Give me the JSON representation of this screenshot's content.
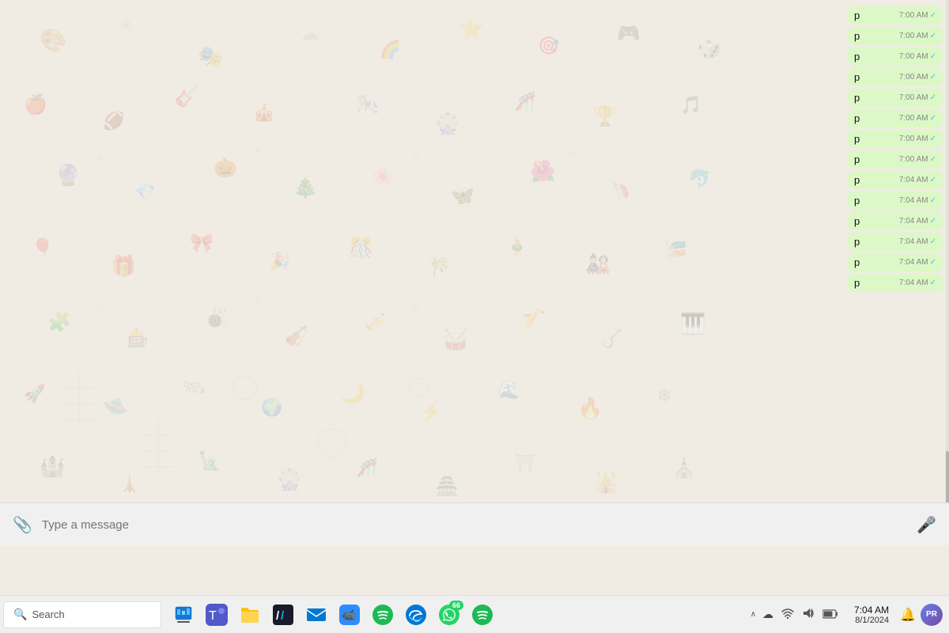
{
  "chat": {
    "background_color": "#f0ece4",
    "messages": [
      {
        "id": 1,
        "text": "p",
        "time": "7:00 AM",
        "read": true
      },
      {
        "id": 2,
        "text": "p",
        "time": "7:00 AM",
        "read": true
      },
      {
        "id": 3,
        "text": "p",
        "time": "7:00 AM",
        "read": true
      },
      {
        "id": 4,
        "text": "p",
        "time": "7:00 AM",
        "read": true
      },
      {
        "id": 5,
        "text": "p",
        "time": "7:00 AM",
        "read": true
      },
      {
        "id": 6,
        "text": "p",
        "time": "7:00 AM",
        "read": true
      },
      {
        "id": 7,
        "text": "p",
        "time": "7:00 AM",
        "read": true
      },
      {
        "id": 8,
        "text": "p",
        "time": "7:00 AM",
        "read": true
      },
      {
        "id": 9,
        "text": "p",
        "time": "7:04 AM",
        "read": true
      },
      {
        "id": 10,
        "text": "p",
        "time": "7:04 AM",
        "read": true
      },
      {
        "id": 11,
        "text": "p",
        "time": "7:04 AM",
        "read": true
      },
      {
        "id": 12,
        "text": "p",
        "time": "7:04 AM",
        "read": true
      },
      {
        "id": 13,
        "text": "p",
        "time": "7:04 AM",
        "read": true
      },
      {
        "id": 14,
        "text": "p",
        "time": "7:04 AM",
        "read": true
      }
    ],
    "input_placeholder": "Type a message"
  },
  "taskbar": {
    "search_placeholder": "Search",
    "search_label": "Search",
    "apps": [
      {
        "name": "task-manager",
        "emoji": "🖥",
        "label": "Task Manager"
      },
      {
        "name": "microsoft-teams",
        "emoji": "💬",
        "label": "Teams",
        "color": "#5059C9"
      },
      {
        "name": "file-explorer",
        "emoji": "📁",
        "label": "File Explorer"
      },
      {
        "name": "dashlane",
        "emoji": "🔑",
        "label": "Dashlane"
      },
      {
        "name": "mail",
        "emoji": "✉",
        "label": "Mail"
      },
      {
        "name": "zoom",
        "emoji": "📹",
        "label": "Zoom"
      },
      {
        "name": "spotify-1",
        "emoji": "🎵",
        "label": "Spotify"
      },
      {
        "name": "edge",
        "emoji": "🌐",
        "label": "Microsoft Edge"
      },
      {
        "name": "whatsapp",
        "emoji": "📱",
        "label": "WhatsApp",
        "badge": "66"
      },
      {
        "name": "spotify-2",
        "emoji": "🎵",
        "label": "Spotify 2"
      }
    ],
    "tray": {
      "chevron_up": "^",
      "cloud_icon": "☁",
      "wifi_icon": "📶",
      "volume_icon": "🔊",
      "battery_icon": "🔋"
    },
    "clock": {
      "time": "7:04 AM",
      "date": "8/1/2024"
    },
    "notification_label": "🔔",
    "profile_label": "PR"
  }
}
